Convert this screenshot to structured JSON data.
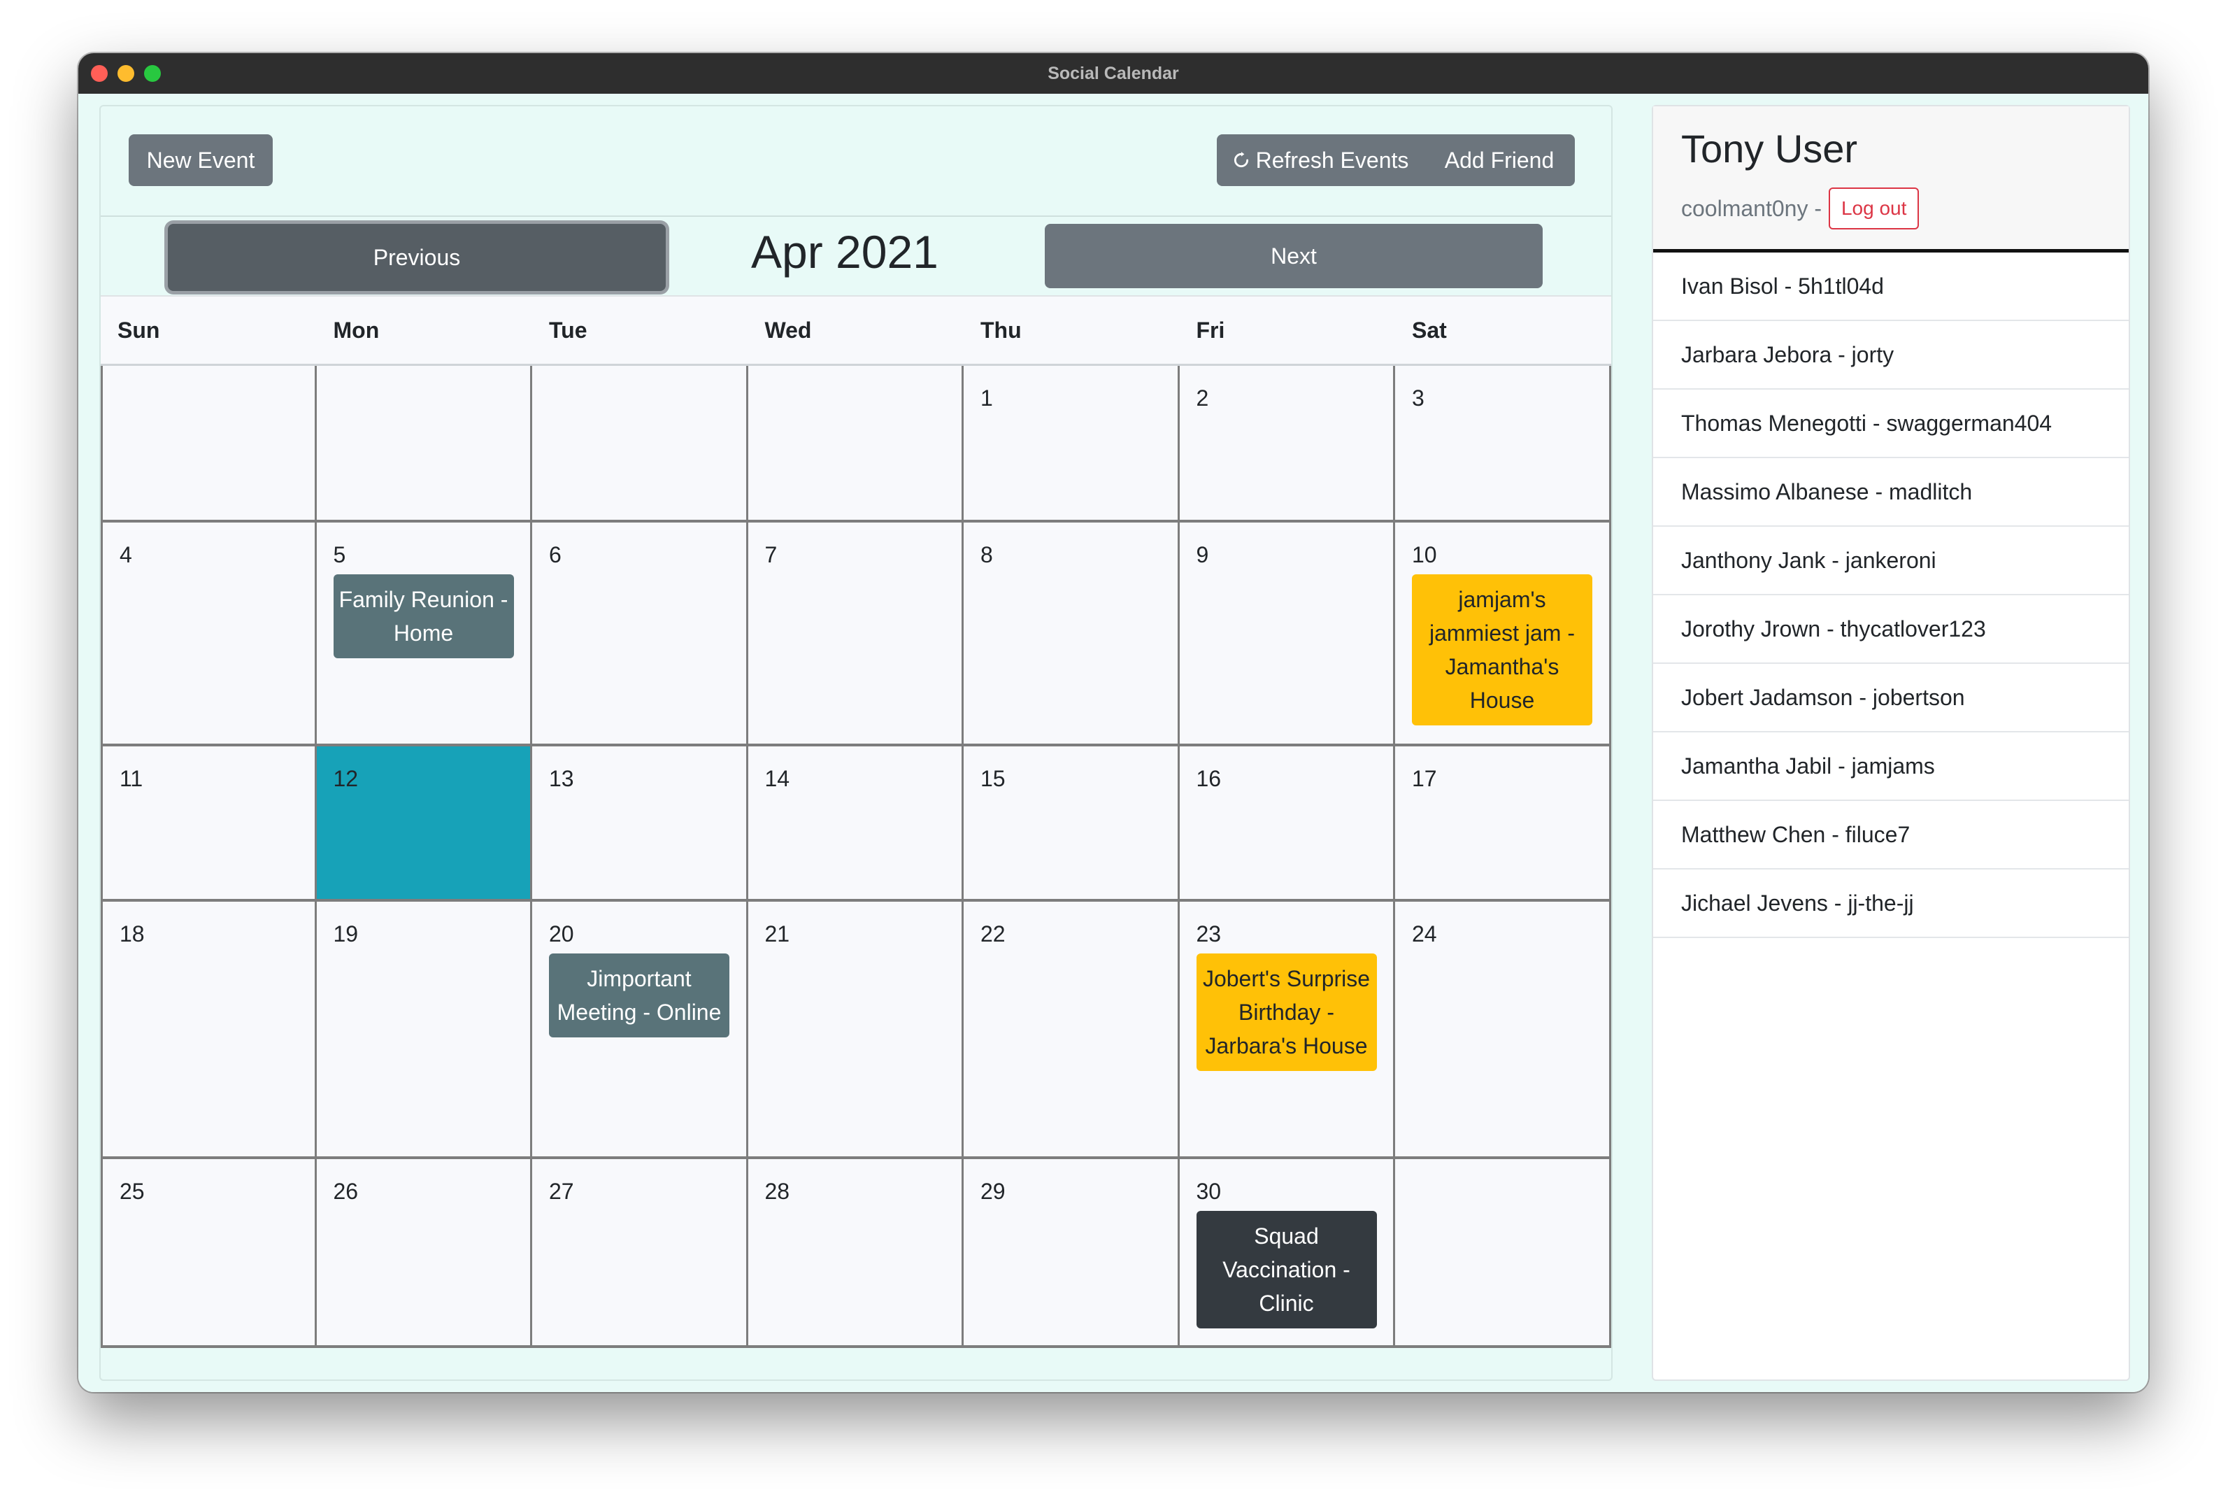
{
  "window": {
    "title": "Social Calendar"
  },
  "toolbar": {
    "new_event_label": "New Event",
    "refresh_icon": "refresh-icon",
    "refresh_label": "Refresh Events",
    "add_friend_label": "Add Friend"
  },
  "calendar": {
    "month_title": "Apr 2021",
    "prev_label": "Previous",
    "next_label": "Next",
    "days_of_week": [
      "Sun",
      "Mon",
      "Tue",
      "Wed",
      "Thu",
      "Fri",
      "Sat"
    ],
    "today": "12",
    "weeks": [
      [
        {
          "day": "",
          "events": []
        },
        {
          "day": "",
          "events": []
        },
        {
          "day": "",
          "events": []
        },
        {
          "day": "",
          "events": []
        },
        {
          "day": "1",
          "events": []
        },
        {
          "day": "2",
          "events": []
        },
        {
          "day": "3",
          "events": []
        }
      ],
      [
        {
          "day": "4",
          "events": []
        },
        {
          "day": "5",
          "events": [
            {
              "title": "Family Reunion - Home",
              "color": "#597379"
            }
          ]
        },
        {
          "day": "6",
          "events": []
        },
        {
          "day": "7",
          "events": []
        },
        {
          "day": "8",
          "events": []
        },
        {
          "day": "9",
          "events": []
        },
        {
          "day": "10",
          "events": [
            {
              "title": "jamjam's jammiest jam - Jamantha's House",
              "color": "#ffc107"
            }
          ]
        }
      ],
      [
        {
          "day": "11",
          "events": []
        },
        {
          "day": "12",
          "events": [],
          "today": true
        },
        {
          "day": "13",
          "events": []
        },
        {
          "day": "14",
          "events": []
        },
        {
          "day": "15",
          "events": []
        },
        {
          "day": "16",
          "events": []
        },
        {
          "day": "17",
          "events": []
        }
      ],
      [
        {
          "day": "18",
          "events": []
        },
        {
          "day": "19",
          "events": []
        },
        {
          "day": "20",
          "events": [
            {
              "title": "Jimportant Meeting - Online",
              "color": "#597379"
            }
          ]
        },
        {
          "day": "21",
          "events": []
        },
        {
          "day": "22",
          "events": []
        },
        {
          "day": "23",
          "events": [
            {
              "title": "Jobert's Surprise Birthday - Jarbara's House",
              "color": "#ffc107"
            }
          ]
        },
        {
          "day": "24",
          "events": []
        }
      ],
      [
        {
          "day": "25",
          "events": []
        },
        {
          "day": "26",
          "events": []
        },
        {
          "day": "27",
          "events": []
        },
        {
          "day": "28",
          "events": []
        },
        {
          "day": "29",
          "events": []
        },
        {
          "day": "30",
          "events": [
            {
              "title": "Squad Vaccination - Clinic",
              "color": "#343a40"
            }
          ]
        },
        {
          "day": "",
          "events": []
        }
      ]
    ]
  },
  "profile": {
    "name": "Tony User",
    "handle": "coolmant0ny -",
    "logout_label": "Log out"
  },
  "friends": [
    "Ivan Bisol - 5h1tl04d",
    "Jarbara Jebora - jorty",
    "Thomas Menegotti - swaggerman404",
    "Massimo Albanese - madlitch",
    "Janthony Jank - jankeroni",
    "Jorothy Jrown - thycatlover123",
    "Jobert Jadamson - jobertson",
    "Jamantha Jabil - jamjams",
    "Matthew Chen - filuce7",
    "Jichael Jevens - jj-the-jj"
  ],
  "colors": {
    "accent_today": "#17a2b8",
    "button": "#6c757d",
    "event_slate": "#597379",
    "event_yellow": "#ffc107",
    "event_dark": "#343a40",
    "logout": "#dc3545"
  }
}
